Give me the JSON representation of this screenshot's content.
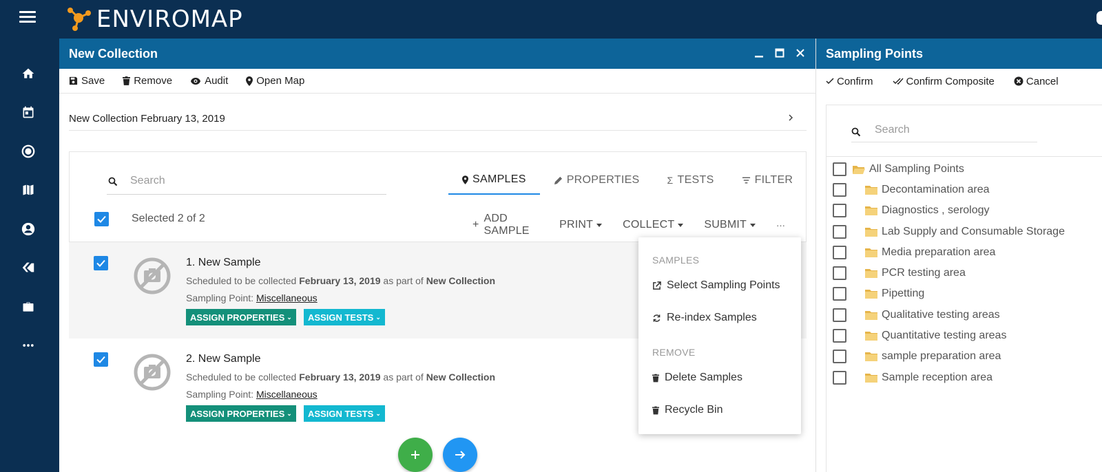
{
  "app": {
    "brand": "ENVIROMAP",
    "colors": {
      "topbar": "#0b2f52",
      "header": "#0d6499",
      "accent": "#1e88e5",
      "props_btn": "#14907a",
      "tests_btn": "#13b8d0",
      "fab_add": "#3fae49",
      "fab_next": "#2196f3"
    }
  },
  "sidebar": {
    "items": [
      {
        "icon": "home-icon"
      },
      {
        "icon": "calendar-icon"
      },
      {
        "icon": "target-icon"
      },
      {
        "icon": "map-icon"
      },
      {
        "icon": "account-icon"
      },
      {
        "icon": "tags-icon"
      },
      {
        "icon": "briefcase-icon"
      },
      {
        "icon": "more-icon"
      }
    ]
  },
  "collection_panel": {
    "title": "New Collection",
    "toolbar": {
      "save": "Save",
      "remove": "Remove",
      "audit": "Audit",
      "open_map": "Open Map"
    },
    "collection_name": "New Collection February 13, 2019",
    "search_placeholder": "Search",
    "tabs": {
      "samples": "SAMPLES",
      "properties": "PROPERTIES",
      "tests": "TESTS",
      "filter": "FILTER"
    },
    "selection_text": "Selected 2 of 2",
    "actions": {
      "add_sample": "ADD SAMPLE",
      "print": "PRINT",
      "collect": "COLLECT",
      "submit": "SUBMIT",
      "more": "···"
    },
    "samples": [
      {
        "name": "1. New Sample",
        "desc_prefix": "Scheduled to be collected ",
        "date": "February 13, 2019",
        "desc_mid": " as part of ",
        "collection": "New Collection",
        "point_label": "Sampling Point: ",
        "point": "Miscellaneous",
        "assign_properties": "ASSIGN PROPERTIES",
        "assign_tests": "ASSIGN TESTS"
      },
      {
        "name": "2. New Sample",
        "desc_prefix": "Scheduled to be collected ",
        "date": "February 13, 2019",
        "desc_mid": " as part of ",
        "collection": "New Collection",
        "point_label": "Sampling Point: ",
        "point": "Miscellaneous",
        "assign_properties": "ASSIGN PROPERTIES",
        "assign_tests": "ASSIGN TESTS"
      }
    ]
  },
  "dropdown": {
    "samples_header": "SAMPLES",
    "select_sampling_points": "Select Sampling Points",
    "reindex_samples": "Re-index Samples",
    "remove_header": "REMOVE",
    "delete_samples": "Delete Samples",
    "recycle_bin": "Recycle Bin"
  },
  "sampling_points_panel": {
    "title": "Sampling Points",
    "toolbar": {
      "confirm": "Confirm",
      "confirm_composite": "Confirm Composite",
      "cancel": "Cancel"
    },
    "search_placeholder": "Search",
    "tree": [
      "All Sampling Points",
      "Decontamination area",
      "Diagnostics , serology",
      "Lab Supply and Consumable Storage",
      "Media preparation area",
      "PCR testing area",
      "Pipetting",
      "Qualitative testing areas",
      "Quantitative testing areas",
      "sample preparation area",
      "Sample reception area"
    ]
  }
}
